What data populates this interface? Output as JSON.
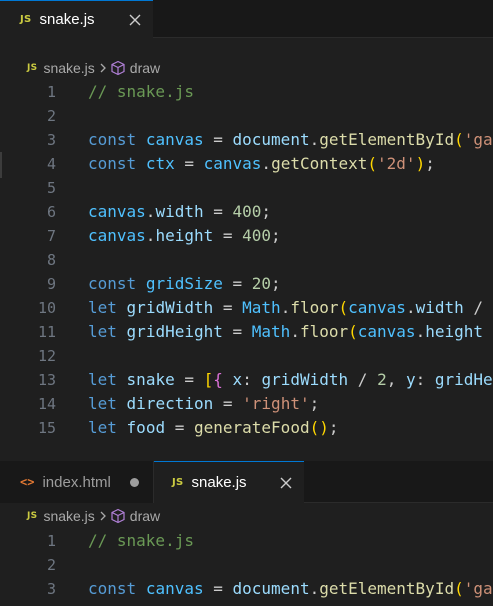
{
  "top_group": {
    "tab": {
      "badge": "JS",
      "label": "snake.js"
    },
    "breadcrumb": {
      "badge": "JS",
      "file": "snake.js",
      "symbol": "draw"
    },
    "lines": [
      {
        "n": "1",
        "tokens": [
          [
            "cm",
            "// snake.js"
          ]
        ]
      },
      {
        "n": "2",
        "tokens": []
      },
      {
        "n": "3",
        "tokens": [
          [
            "kw",
            "const"
          ],
          [
            "pl",
            " "
          ],
          [
            "cvar",
            "canvas"
          ],
          [
            "pl",
            " = "
          ],
          [
            "var",
            "document"
          ],
          [
            "pl",
            "."
          ],
          [
            "fn",
            "getElementById"
          ],
          [
            "b1",
            "("
          ],
          [
            "str",
            "'ga"
          ]
        ]
      },
      {
        "n": "4",
        "tokens": [
          [
            "kw",
            "const"
          ],
          [
            "pl",
            " "
          ],
          [
            "cvar",
            "ctx"
          ],
          [
            "pl",
            " = "
          ],
          [
            "cvar",
            "canvas"
          ],
          [
            "pl",
            "."
          ],
          [
            "fn",
            "getContext"
          ],
          [
            "b1",
            "("
          ],
          [
            "str",
            "'2d'"
          ],
          [
            "b1",
            ")"
          ],
          [
            "pl",
            ";"
          ]
        ]
      },
      {
        "n": "5",
        "tokens": []
      },
      {
        "n": "6",
        "tokens": [
          [
            "cvar",
            "canvas"
          ],
          [
            "pl",
            "."
          ],
          [
            "var",
            "width"
          ],
          [
            "pl",
            " = "
          ],
          [
            "num",
            "400"
          ],
          [
            "pl",
            ";"
          ]
        ]
      },
      {
        "n": "7",
        "tokens": [
          [
            "cvar",
            "canvas"
          ],
          [
            "pl",
            "."
          ],
          [
            "var",
            "height"
          ],
          [
            "pl",
            " = "
          ],
          [
            "num",
            "400"
          ],
          [
            "pl",
            ";"
          ]
        ]
      },
      {
        "n": "8",
        "tokens": []
      },
      {
        "n": "9",
        "tokens": [
          [
            "kw",
            "const"
          ],
          [
            "pl",
            " "
          ],
          [
            "cvar",
            "gridSize"
          ],
          [
            "pl",
            " = "
          ],
          [
            "num",
            "20"
          ],
          [
            "pl",
            ";"
          ]
        ]
      },
      {
        "n": "10",
        "tokens": [
          [
            "kw",
            "let"
          ],
          [
            "pl",
            " "
          ],
          [
            "var",
            "gridWidth"
          ],
          [
            "pl",
            " = "
          ],
          [
            "cvar",
            "Math"
          ],
          [
            "pl",
            "."
          ],
          [
            "fn",
            "floor"
          ],
          [
            "b1",
            "("
          ],
          [
            "cvar",
            "canvas"
          ],
          [
            "pl",
            "."
          ],
          [
            "var",
            "width"
          ],
          [
            "pl",
            " /"
          ]
        ]
      },
      {
        "n": "11",
        "tokens": [
          [
            "kw",
            "let"
          ],
          [
            "pl",
            " "
          ],
          [
            "var",
            "gridHeight"
          ],
          [
            "pl",
            " = "
          ],
          [
            "cvar",
            "Math"
          ],
          [
            "pl",
            "."
          ],
          [
            "fn",
            "floor"
          ],
          [
            "b1",
            "("
          ],
          [
            "cvar",
            "canvas"
          ],
          [
            "pl",
            "."
          ],
          [
            "var",
            "height"
          ]
        ]
      },
      {
        "n": "12",
        "tokens": []
      },
      {
        "n": "13",
        "tokens": [
          [
            "kw",
            "let"
          ],
          [
            "pl",
            " "
          ],
          [
            "var",
            "snake"
          ],
          [
            "pl",
            " = "
          ],
          [
            "b1",
            "["
          ],
          [
            "b2",
            "{"
          ],
          [
            "pl",
            " "
          ],
          [
            "var",
            "x"
          ],
          [
            "pl",
            ": "
          ],
          [
            "var",
            "gridWidth"
          ],
          [
            "pl",
            " / "
          ],
          [
            "num",
            "2"
          ],
          [
            "pl",
            ", "
          ],
          [
            "var",
            "y"
          ],
          [
            "pl",
            ": "
          ],
          [
            "var",
            "gridHe"
          ]
        ]
      },
      {
        "n": "14",
        "tokens": [
          [
            "kw",
            "let"
          ],
          [
            "pl",
            " "
          ],
          [
            "var",
            "direction"
          ],
          [
            "pl",
            " = "
          ],
          [
            "str",
            "'right'"
          ],
          [
            "pl",
            ";"
          ]
        ]
      },
      {
        "n": "15",
        "tokens": [
          [
            "kw",
            "let"
          ],
          [
            "pl",
            " "
          ],
          [
            "var",
            "food"
          ],
          [
            "pl",
            " = "
          ],
          [
            "fn",
            "generateFood"
          ],
          [
            "b1",
            "()"
          ],
          [
            "pl",
            ";"
          ]
        ]
      }
    ]
  },
  "bottom_group": {
    "tabs": [
      {
        "badge": "<>",
        "label": "index.html"
      },
      {
        "badge": "JS",
        "label": "snake.js"
      }
    ],
    "breadcrumb": {
      "badge": "JS",
      "file": "snake.js",
      "symbol": "draw"
    },
    "lines": [
      {
        "n": "1",
        "tokens": [
          [
            "cm",
            "// snake.js"
          ]
        ]
      },
      {
        "n": "2",
        "tokens": []
      },
      {
        "n": "3",
        "tokens": [
          [
            "kw",
            "const"
          ],
          [
            "pl",
            " "
          ],
          [
            "cvar",
            "canvas"
          ],
          [
            "pl",
            " = "
          ],
          [
            "var",
            "document"
          ],
          [
            "pl",
            "."
          ],
          [
            "fn",
            "getElementById"
          ],
          [
            "b1",
            "("
          ],
          [
            "str",
            "'ga"
          ]
        ]
      }
    ]
  },
  "colors": {
    "accent": "#0078d4",
    "js_badge": "#cbcb41",
    "html_badge": "#e37933",
    "background": "#1f1f1f"
  },
  "icons": {
    "close": "close-icon",
    "dirty": "unsaved-dot-icon",
    "chevron": "chevron-right-icon",
    "symbol": "method-cube-icon"
  }
}
